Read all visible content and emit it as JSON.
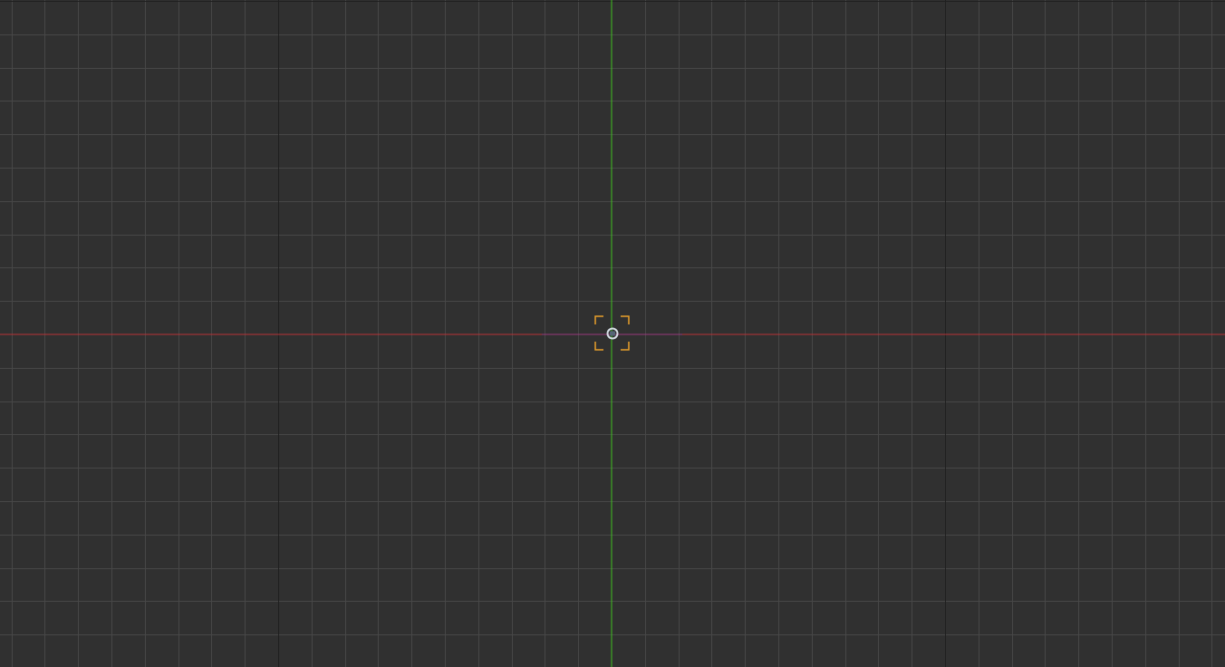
{
  "viewport": {
    "view": "top-orthographic",
    "background_color": "#303030",
    "grid": {
      "visible": true,
      "minor_color": "#474747",
      "major_color": "#1f1f1f"
    },
    "axes": {
      "x_axis_color": "#b83236",
      "y_axis_color": "#3fbf20",
      "z_axis_color": "#8a3a9a"
    },
    "cursor_3d": {
      "icon": "3d-cursor-icon",
      "ring_color": "#d8e0e8",
      "fill_color": "#556677"
    },
    "selection_brackets": {
      "icon": "selection-bracket-icon",
      "color": "#e9a02a"
    }
  }
}
